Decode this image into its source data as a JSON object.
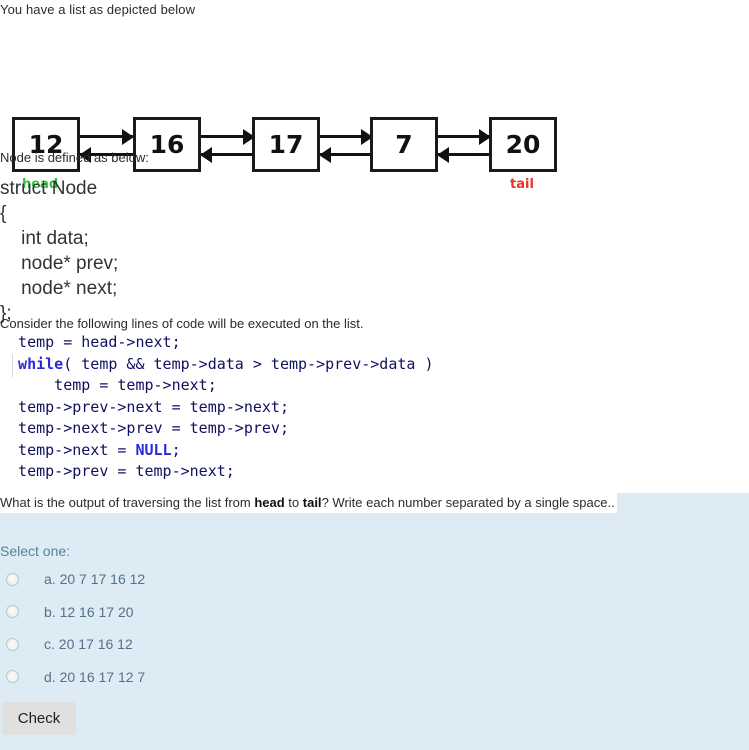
{
  "intro": "You have a list as depicted below",
  "diagram": {
    "nodes": [
      {
        "value": "12",
        "label": "head",
        "label_color": "#35c13b"
      },
      {
        "value": "16",
        "label": "",
        "label_color": ""
      },
      {
        "value": "17",
        "label": "",
        "label_color": ""
      },
      {
        "value": "7",
        "label": "",
        "label_color": ""
      },
      {
        "value": "20",
        "label": "tail",
        "label_color": "#ee3224"
      }
    ],
    "head_label": "head",
    "tail_label": "tail"
  },
  "node_def_intro": "Node is defined as below:",
  "struct_definition": "struct Node\n{\n    int data;\n    node* prev;\n    node* next;\n};",
  "consider_text": "Consider the following lines of code will be executed on the list.",
  "code": {
    "lines": [
      [
        {
          "t": "  temp = head->next;",
          "k": false
        }
      ],
      [
        {
          "t": "  while",
          "k": true
        },
        {
          "t": "( temp && temp->data > temp->prev->data )",
          "k": false
        }
      ],
      [
        {
          "t": "      temp = temp->next;",
          "k": false
        }
      ],
      [
        {
          "t": "  temp->prev->next = temp->next;",
          "k": false
        }
      ],
      [
        {
          "t": "  temp->next->prev = temp->prev;",
          "k": false
        }
      ],
      [
        {
          "t": "  temp->next = ",
          "k": false
        },
        {
          "t": "NULL",
          "k": true
        },
        {
          "t": ";",
          "k": false
        }
      ],
      [
        {
          "t": "  temp->prev = temp->next;",
          "k": false
        }
      ]
    ],
    "keyword_color": "#2b2bd6",
    "text_color": "#101060"
  },
  "question": {
    "prefix": "What is the output of traversing the list from ",
    "bold1": "head",
    "middle": " to ",
    "bold2": "tail",
    "suffix": "? Write each number separated by a single space.."
  },
  "select_one": "Select one:",
  "options": [
    {
      "letter": "a.",
      "text": "20 7 17 16 12"
    },
    {
      "letter": "b.",
      "text": "12 16 17 20"
    },
    {
      "letter": "c.",
      "text": "20 17 16 12"
    },
    {
      "letter": "d.",
      "text": "20 16 17 12 7"
    }
  ],
  "check_label": "Check",
  "colors": {
    "panel_background": "#dcebf4",
    "page_background": "#ffffff",
    "button_background": "#e0e0e0",
    "option_text": "#55718a",
    "select_one_text": "#5b8299"
  }
}
